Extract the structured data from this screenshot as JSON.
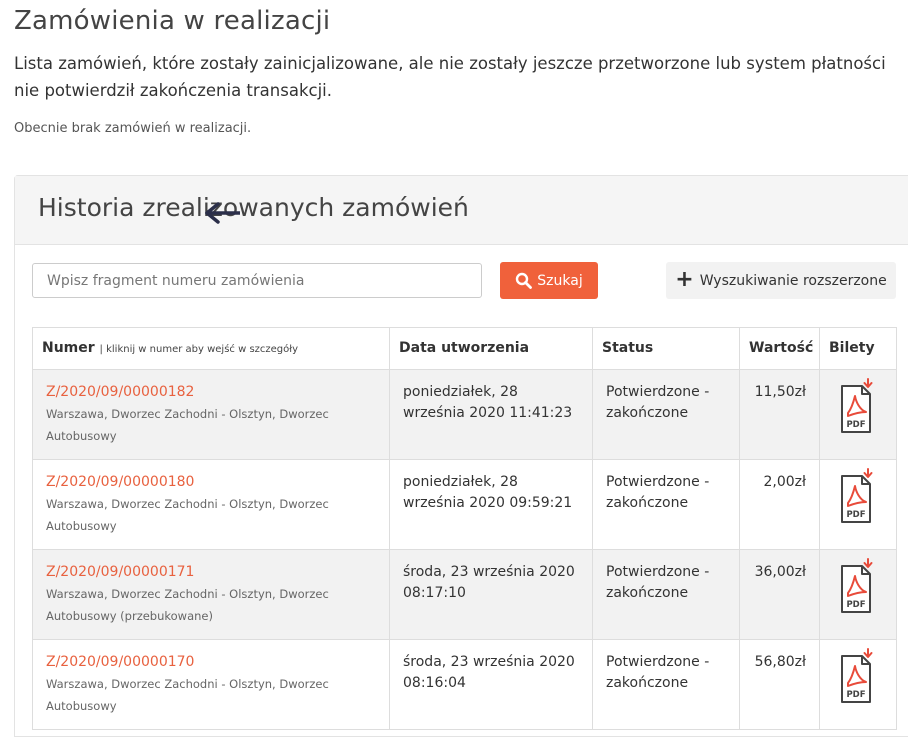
{
  "page": {
    "title": "Zamówienia w realizacji",
    "intro": "Lista zamówień, które zostały zainicjalizowane, ale nie zostały jeszcze przetworzone lub system płatności nie potwierdził zakończenia transakcji.",
    "empty_note": "Obecnie brak zamówień w realizacji."
  },
  "history": {
    "title": "Historia zrealizowanych zamówień",
    "search": {
      "placeholder": "Wpisz fragment numeru zamówienia",
      "button_label": "Szukaj",
      "advanced_label": "Wyszukiwanie rozszerzone"
    },
    "columns": {
      "number": "Numer",
      "number_hint": "| kliknij w numer aby wejść w szczegóły",
      "created": "Data utworzenia",
      "status": "Status",
      "value": "Wartość",
      "tickets": "Bilety"
    },
    "rows": [
      {
        "number": "Z/2020/09/00000182",
        "route": "Warszawa, Dworzec Zachodni - Olsztyn, Dworzec Autobusowy",
        "created": "poniedziałek, 28 września 2020 11:41:23",
        "status": "Potwierdzone - zakończone",
        "value": "11,50zł"
      },
      {
        "number": "Z/2020/09/00000180",
        "route": "Warszawa, Dworzec Zachodni - Olsztyn, Dworzec Autobusowy",
        "created": "poniedziałek, 28 września 2020 09:59:21",
        "status": "Potwierdzone - zakończone",
        "value": "2,00zł"
      },
      {
        "number": "Z/2020/09/00000171",
        "route": "Warszawa, Dworzec Zachodni - Olsztyn, Dworzec Autobusowy (przebukowane)",
        "created": "środa, 23 września 2020 08:17:10",
        "status": "Potwierdzone - zakończone",
        "value": "36,00zł"
      },
      {
        "number": "Z/2020/09/00000170",
        "route": "Warszawa, Dworzec Zachodni - Olsztyn, Dworzec Autobusowy",
        "created": "środa, 23 września 2020 08:16:04",
        "status": "Potwierdzone - zakończone",
        "value": "56,80zł"
      }
    ],
    "pdf_icon_label": "PDF"
  },
  "colors": {
    "accent": "#f0613b",
    "link": "#e8613f",
    "arrow": "#2b2f4a"
  },
  "icons": {
    "search": "search-icon",
    "plus": "plus-icon",
    "pdf": "pdf-download-icon",
    "arrow": "arrow-left-icon"
  }
}
